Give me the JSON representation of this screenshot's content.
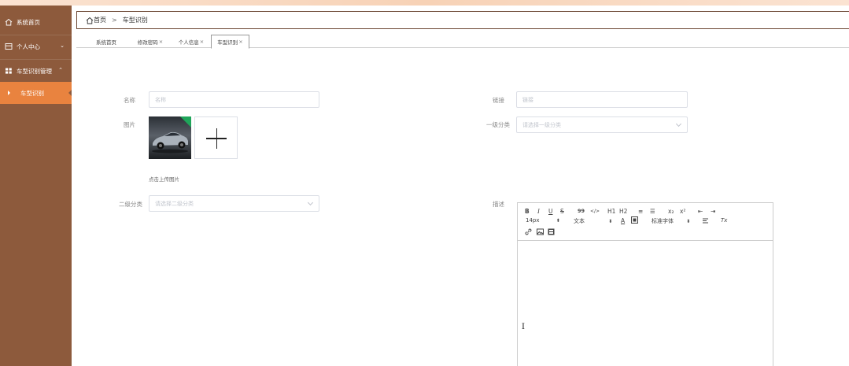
{
  "sidebar": {
    "items": [
      {
        "label": "系统首页",
        "icon": "home-icon"
      },
      {
        "label": "个人中心",
        "icon": "user-center-icon",
        "arrow": "⌄"
      },
      {
        "label": "车型识别管理",
        "icon": "grid-icon",
        "arrow": "⌃"
      },
      {
        "label": "车型识别",
        "active": true
      }
    ]
  },
  "breadcrumb": {
    "home": "首页",
    "separator": ">",
    "current": "车型识别"
  },
  "tabs": [
    {
      "label": "系统首页",
      "closable": false
    },
    {
      "label": "修改密码",
      "closable": true
    },
    {
      "label": "个人信息",
      "closable": true
    },
    {
      "label": "车型识别",
      "closable": true,
      "active": true
    }
  ],
  "close_mark": "×",
  "form": {
    "name": {
      "label": "名称",
      "placeholder": "名称"
    },
    "link": {
      "label": "链接",
      "placeholder": "链接"
    },
    "image": {
      "label": "图片",
      "hint": "点击上传图片"
    },
    "category1": {
      "label": "一级分类",
      "placeholder": "请选择一级分类"
    },
    "category2": {
      "label": "二级分类",
      "placeholder": "请选择二级分类"
    },
    "description": {
      "label": "描述"
    }
  },
  "editor": {
    "row1": [
      "B",
      "I",
      "U",
      "S",
      "99",
      "</>",
      "H1",
      "H2",
      "≡",
      "☰",
      "x₂",
      "x²",
      "⇤",
      "⇥"
    ],
    "font_size": "14px",
    "text_style": "文本",
    "font_family": "标准字体",
    "select_arrow": "⬍",
    "clear_format": "Tx",
    "caret": "I"
  },
  "colors": {
    "sidebar": "#8d5a3c",
    "active": "#e9833f",
    "border": "#6b4632"
  }
}
